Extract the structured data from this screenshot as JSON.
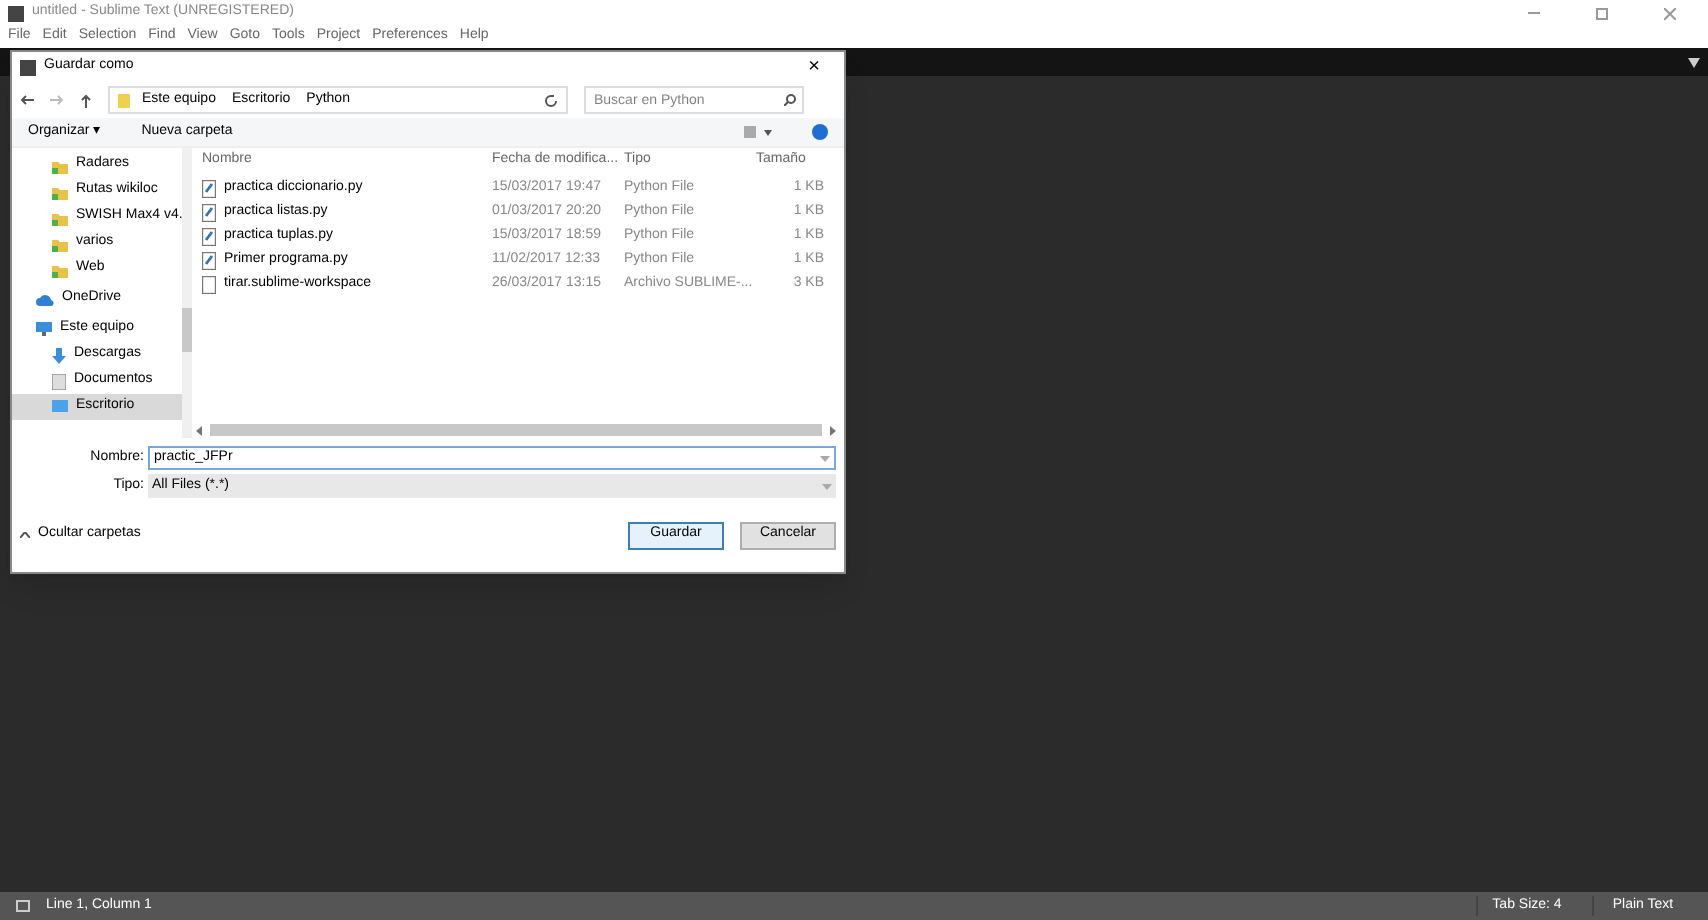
{
  "window": {
    "title": "untitled - Sublime Text (UNREGISTERED)"
  },
  "menu": [
    "File",
    "Edit",
    "Selection",
    "Find",
    "View",
    "Goto",
    "Tools",
    "Project",
    "Preferences",
    "Help"
  ],
  "dialog": {
    "title": "Guardar como",
    "close": "×",
    "breadcrumb": [
      "Este equipo",
      "Escritorio",
      "Python"
    ],
    "search": {
      "placeholder": "Buscar en Python"
    },
    "toolbar": [
      "Organizar ▾",
      "Nueva carpeta"
    ],
    "sidebar": [
      {
        "label": "Radares",
        "kind": "folder",
        "selected": false
      },
      {
        "label": "Rutas wikiloc",
        "kind": "folder",
        "selected": false
      },
      {
        "label": "SWISH Max4 v4.",
        "kind": "folder",
        "selected": false
      },
      {
        "label": "varios",
        "kind": "folder",
        "selected": false
      },
      {
        "label": "Web",
        "kind": "folder",
        "selected": false
      },
      {
        "label": "OneDrive",
        "kind": "cloud",
        "selected": false
      },
      {
        "label": "Este equipo",
        "kind": "computer",
        "selected": false
      },
      {
        "label": "Descargas",
        "kind": "download",
        "selected": false
      },
      {
        "label": "Documentos",
        "kind": "documents",
        "selected": false
      },
      {
        "label": "Escritorio",
        "kind": "desktop",
        "selected": true
      }
    ],
    "columns": [
      "Nombre",
      "Fecha de modifica...",
      "Tipo",
      "Tamaño"
    ],
    "files": [
      {
        "name": "practica diccionario.py",
        "date": "15/03/2017 19:47",
        "type": "Python File",
        "size": "1 KB",
        "kind": "python"
      },
      {
        "name": "practica listas.py",
        "date": "01/03/2017 20:20",
        "type": "Python File",
        "size": "1 KB",
        "kind": "python"
      },
      {
        "name": "practica tuplas.py",
        "date": "15/03/2017 18:59",
        "type": "Python File",
        "size": "1 KB",
        "kind": "python"
      },
      {
        "name": "Primer programa.py",
        "date": "11/02/2017 12:33",
        "type": "Python File",
        "size": "1 KB",
        "kind": "python"
      },
      {
        "name": "tirar.sublime-workspace",
        "date": "26/03/2017 13:15",
        "type": "Archivo SUBLIME-...",
        "size": "3 KB",
        "kind": "file"
      }
    ],
    "name_label": "Nombre:",
    "name_value": "practic_JFPr",
    "type_label": "Tipo:",
    "type_value": "All Files (*.*)",
    "hide_folders": "Ocultar carpetas",
    "buttons": [
      "Guardar",
      "Cancelar"
    ]
  },
  "status_bar": {
    "position": "Line 1, Column 1",
    "tab_size": "Tab Size: 4",
    "syntax": "Plain Text"
  }
}
